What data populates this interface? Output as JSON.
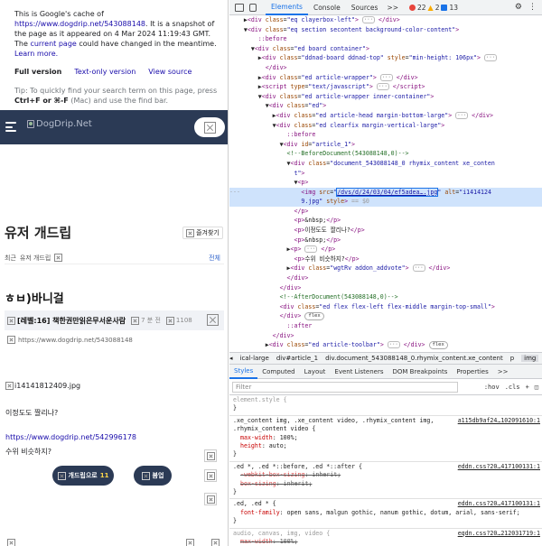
{
  "cache": {
    "l1": "This is Google's cache of",
    "url": "https://www.dogdrip.net/543088148",
    "l1b": ". It is a snapshot of the page as it appeared on 4 Mar 2024 11:19:43 GMT. The",
    "current_page": "current page",
    "l1c": "could have changed in the meantime.",
    "learn_more": "Learn more.",
    "full_version": "Full version",
    "text_only": "Text-only version",
    "view_source": "View source",
    "tip_a": "Tip: To quickly find your search term on this page, press",
    "tip_keys": "Ctrl+F or ⌘-F",
    "tip_b": "(Mac) and use the find bar."
  },
  "site": {
    "logo_alt": "DogDrip.Net",
    "board_title": "유저 개드립",
    "fav_label": "즐겨찾기",
    "crumb_recent": "최근",
    "crumb_board": "유저 개드립",
    "crumb_all": "전체",
    "section_title": "ㅎㅂ)바니걸",
    "post_title": "[레벨:16] 책한권만읽은무서운사람",
    "post_time": "7 분 전",
    "post_views": "1108",
    "post_url": "https://www.dogdrip.net/543088148",
    "img_alt": "i14141812409.jpg",
    "p1": "이정도도 짤리나?",
    "link2": "https://www.dogdrip.net/542996178",
    "p2": "수위 비슷하지?",
    "btn_vote_label": "개드립으로",
    "btn_vote_count": "11",
    "btn_down_label": "붐업"
  },
  "devtools": {
    "tabs": [
      "Elements",
      "Console",
      "Sources"
    ],
    "active_tab": "Elements",
    "more": ">>",
    "errors": "22",
    "warnings": "2",
    "infos": "13",
    "breadcrumbs": [
      "ical-large",
      "div#article_1",
      "div.document_543088148_0.rhymix_content.xe_content",
      "p",
      "img"
    ],
    "style_tabs": [
      "Styles",
      "Computed",
      "Layout",
      "Event Listeners",
      "DOM Breakpoints",
      "Properties",
      ">>"
    ],
    "filter_placeholder": "Filter",
    "filter_opts": [
      ":hov",
      ".cls",
      "+"
    ],
    "selected_marker": "== $0",
    "img_src": "/dvs/d/24/03/04/ef5adea….jpg",
    "img_alt_attr": "i1414124",
    "flex_badge": "flex",
    "rules": [
      {
        "selector": "element.style {",
        "src": "",
        "props": []
      },
      {
        "selector": ".xe_content img, .xe_content video, .rhymix_content img, .rhymix_content video {",
        "src": "a115db9af24…102091610:1",
        "props": [
          [
            "max-width",
            "100%;"
          ],
          [
            "height",
            "auto;"
          ]
        ]
      },
      {
        "selector": ".ed *, .ed *::before, .ed *::after {",
        "src": "eddn.css?20…417100131:1",
        "props": [
          [
            "-webkit-box-sizing",
            "inherit;"
          ],
          [
            "box-sizing",
            "inherit;"
          ]
        ]
      },
      {
        "selector": ".ed, .ed * {",
        "src": "eddn.css?20…417100131:1",
        "props": [
          [
            "font-family",
            "open sans, malgun gothic, nanum gothic, dotum, arial, sans-serif;"
          ]
        ]
      },
      {
        "selector": "audio, canvas, img, video {",
        "src": "eqdn.css?20…212031719:1",
        "props": [
          [
            "max-width",
            "100%;"
          ]
        ]
      }
    ]
  },
  "colors": {
    "site_nav": "#2b3a55",
    "link": "#1a0dab",
    "dt_active": "#1a73e8",
    "error": "#e8453c",
    "warning": "#f9ab00",
    "info": "#1a73e8"
  }
}
